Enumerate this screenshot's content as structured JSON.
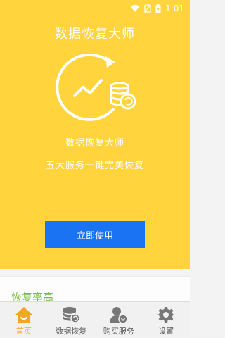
{
  "status_bar": {
    "time": "1:01",
    "icons": [
      "wifi-icon",
      "no-sim-icon",
      "battery-charging-icon"
    ]
  },
  "hero": {
    "app_title": "数据恢复大师",
    "heading": "数据恢复大师",
    "subheading": "五大服务一键完美恢复",
    "cta_label": "立即使用"
  },
  "feature_card": {
    "title": "恢复率高"
  },
  "bottom_nav": {
    "items": [
      {
        "label": "首页",
        "icon": "home-icon",
        "active": true
      },
      {
        "label": "数据恢复",
        "icon": "database-restore-icon",
        "active": false
      },
      {
        "label": "购买服务",
        "icon": "user-service-icon",
        "active": false
      },
      {
        "label": "设置",
        "icon": "gear-icon",
        "active": false
      }
    ]
  },
  "colors": {
    "hero_bg": "#FFD43D",
    "cta_bg": "#1a73f2",
    "feature_title": "#7ac143",
    "nav_active": "#f5a623"
  }
}
